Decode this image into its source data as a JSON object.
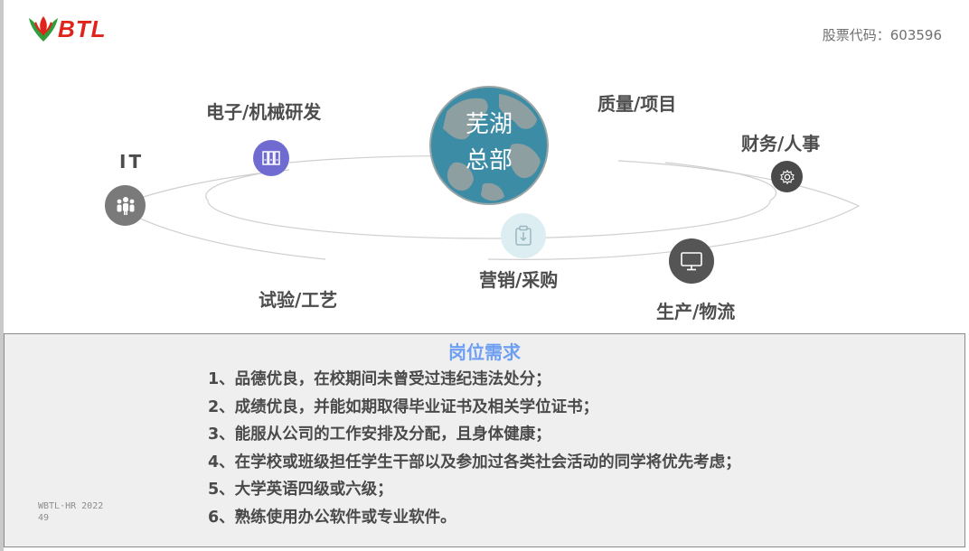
{
  "header": {
    "logo_text": "BTL",
    "stock_code": "股票代码：603596"
  },
  "hub": {
    "line1": "芜湖",
    "line2": "总部"
  },
  "departments": [
    {
      "label": "电子/机械研发",
      "icon": "binders-icon",
      "color": "#6f6bd0"
    },
    {
      "label": "质量/项目"
    },
    {
      "label": "财务/人事",
      "icon": "gear-icon",
      "color": "#4a4a4a"
    },
    {
      "label": "IT",
      "icon": "people-icon",
      "color": "#7a7a7a"
    },
    {
      "label": "营销/采购",
      "icon": "clipboard-icon",
      "color": "#dceef2"
    },
    {
      "label": "试验/工艺"
    },
    {
      "label": "生产/物流",
      "icon": "monitor-icon",
      "color": "#555555"
    }
  ],
  "requirements": {
    "title": "岗位需求",
    "items": [
      "1、品德优良，在校期间未曾受过违纪违法处分；",
      "2、成绩优良，并能如期取得毕业证书及相关学位证书；",
      "3、能服从公司的工作安排及分配，且身体健康；",
      "4、在学校或班级担任学生干部以及参加过各类社会活动的同学将优先考虑；",
      "5、大学英语四级或六级；",
      "6、熟练使用办公软件或专业软件。"
    ]
  },
  "footer": {
    "line1": "WBTL·HR 2022",
    "line2": "49"
  }
}
